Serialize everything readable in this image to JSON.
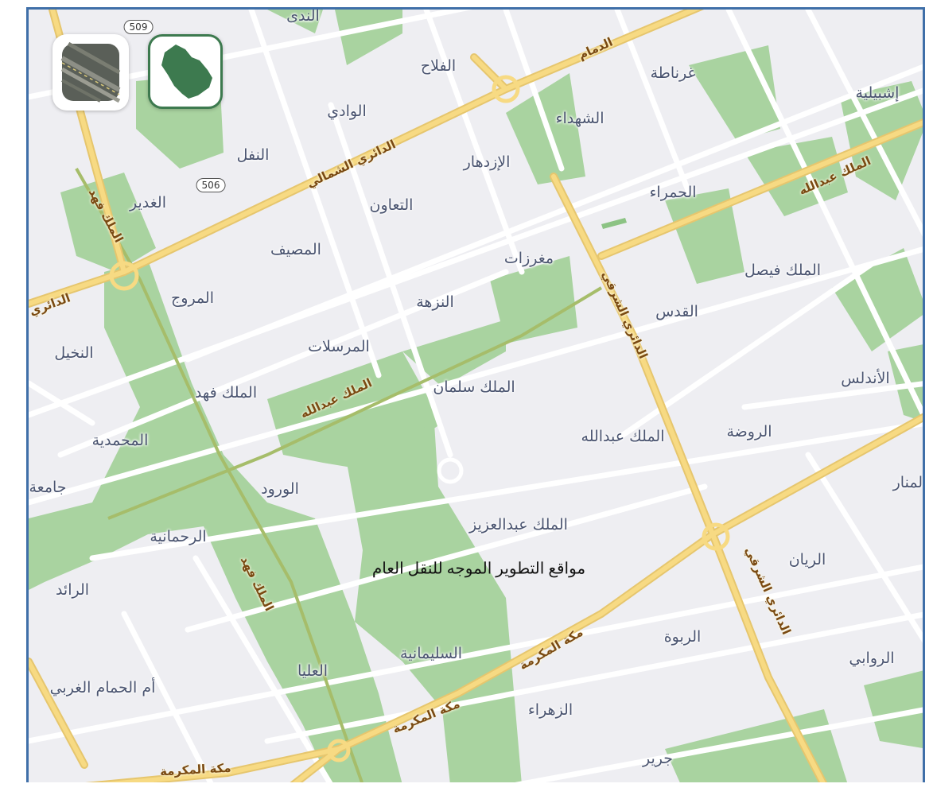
{
  "overlay_text": "مواقع التطوير الموجه للنقل العام",
  "layer_buttons": {
    "satellite_icon": "satellite-imagery-icon",
    "region_icon": "saudi-arabia-map-icon"
  },
  "route_shields": [
    "509",
    "506"
  ],
  "neighborhoods": {
    "nada": "الندى",
    "falah": "الفلاح",
    "ghirnata": "غرناطة",
    "ishbiliya": "إشبيلية",
    "wadi": "الوادي",
    "shuhada": "الشهداء",
    "nafal": "النفل",
    "izdihar": "الإزدهار",
    "ghadir": "الغدير",
    "taawun": "التعاون",
    "hamra": "الحمراء",
    "masif": "المصيف",
    "mughrizat": "مغرزات",
    "malik_faisal": "الملك فيصل",
    "muruj": "المروج",
    "nuzha": "النزهة",
    "quds": "القدس",
    "nakheel": "النخيل",
    "mursalat": "المرسلات",
    "malik_fahd_district": "الملك فهد",
    "malik_salman": "الملك سلمان",
    "andalus": "الأندلس",
    "muhammadiya": "المحمدية",
    "malik_abdullah": "الملك عبدالله",
    "rawda": "الروضة",
    "jamia": "جامعة",
    "wurud": "الورود",
    "manar": "المنار",
    "malik_abdulaziz": "الملك عبدالعزيز",
    "rahmaniya": "الرحمانية",
    "rayyan": "الريان",
    "raid": "الرائد",
    "rabwa": "الربوة",
    "sulaimaniya": "السليمانية",
    "rawabi": "الروابي",
    "olaya": "العليا",
    "umm_alhamam": "أم الحمام الغربي",
    "zahra": "الزهراء",
    "jarir": "جرير"
  },
  "roads": {
    "dammam": "الدمام",
    "northern_ring": "الدائري الشمالي",
    "king_abdullah_ne": "الملك عبدالله",
    "king_fahd_north": "الملك فهد",
    "ring_west": "الدائري",
    "eastern_ring_1": "الدائري الشرقي",
    "king_abdullah_mid": "الملك عبدالله",
    "eastern_ring_2": "الدائري الشرقي",
    "makkah_1": "مكة المكرمة",
    "king_fahd_south": "الملك فهد",
    "makkah_2": "مكة المكرمة",
    "makkah_3": "مكة المكرمة"
  },
  "colors": {
    "park": "#a9d3a0",
    "major_road": "#f7da83",
    "frame_border": "#3f6fa8",
    "region_button_green": "#3d7a4f"
  }
}
